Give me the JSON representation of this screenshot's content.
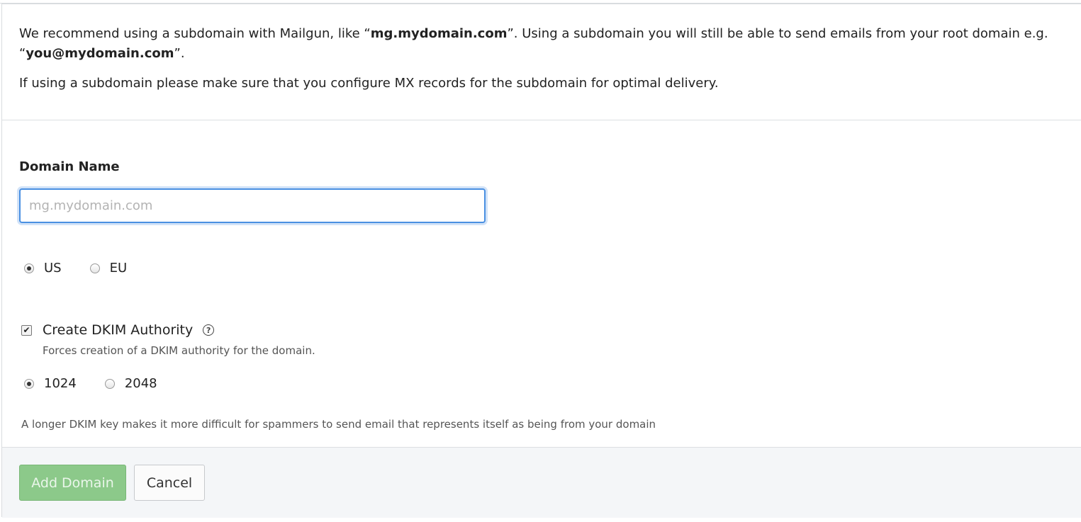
{
  "intro": {
    "p1_a": "We recommend using a subdomain with Mailgun, like “",
    "p1_b": "mg.mydomain.com",
    "p1_c": "”. Using a subdomain you will still be able to send emails from your root domain e.g. “",
    "p1_d": "you@mydomain.com",
    "p1_e": "”.",
    "p2": "If using a subdomain please make sure that you configure MX records for the subdomain for optimal delivery."
  },
  "domain_field": {
    "label": "Domain Name",
    "placeholder": "mg.mydomain.com",
    "value": ""
  },
  "region": {
    "options": [
      "US",
      "EU"
    ],
    "selected": "US"
  },
  "dkim": {
    "checkbox_label": "Create DKIM Authority",
    "checked": true,
    "description": "Forces creation of a DKIM authority for the domain.",
    "help_glyph": "?",
    "key_sizes": [
      "1024",
      "2048"
    ],
    "selected_key_size": "1024",
    "note": "A longer DKIM key makes it more difficult for spammers to send email that represents itself as being from your domain"
  },
  "footer": {
    "add_label": "Add Domain",
    "cancel_label": "Cancel"
  },
  "colors": {
    "focus_border": "#4a90e2",
    "add_button_bg": "#8cc98a",
    "footer_bg": "#f4f6f8"
  }
}
